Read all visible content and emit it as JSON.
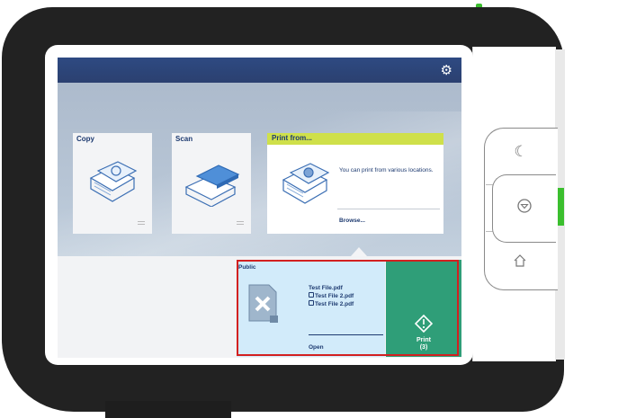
{
  "colors": {
    "housing": "#222222",
    "led": "#3bbf2e",
    "topbar": "#2b4070",
    "print_header": "#cfe04a",
    "job_panel": "#d2ebfa",
    "print_button": "#2f9e78",
    "highlight": "#d32020"
  },
  "topbar": {
    "settings_icon": "gear-icon"
  },
  "tiles": {
    "copy": {
      "label": "Copy",
      "icon": "copy-document-icon"
    },
    "scan": {
      "label": "Scan",
      "icon": "scanner-icon"
    },
    "print_from": {
      "label": "Print from...",
      "description": "You can print from various locations.",
      "browse": "Browse...",
      "icon": "print-documents-icon"
    }
  },
  "job": {
    "location": "Public",
    "files": [
      "Test File.pdf",
      "Test File 2.pdf",
      "Test File 2.pdf"
    ],
    "locked": [
      false,
      true,
      true
    ],
    "open": "Open",
    "icon": "document-error-icon"
  },
  "print_button": {
    "label": "Print",
    "count": "(3)",
    "icon": "start-print-icon"
  },
  "side_buttons": {
    "sleep": "moon-icon",
    "start": "power-icon",
    "home": "home-icon"
  }
}
